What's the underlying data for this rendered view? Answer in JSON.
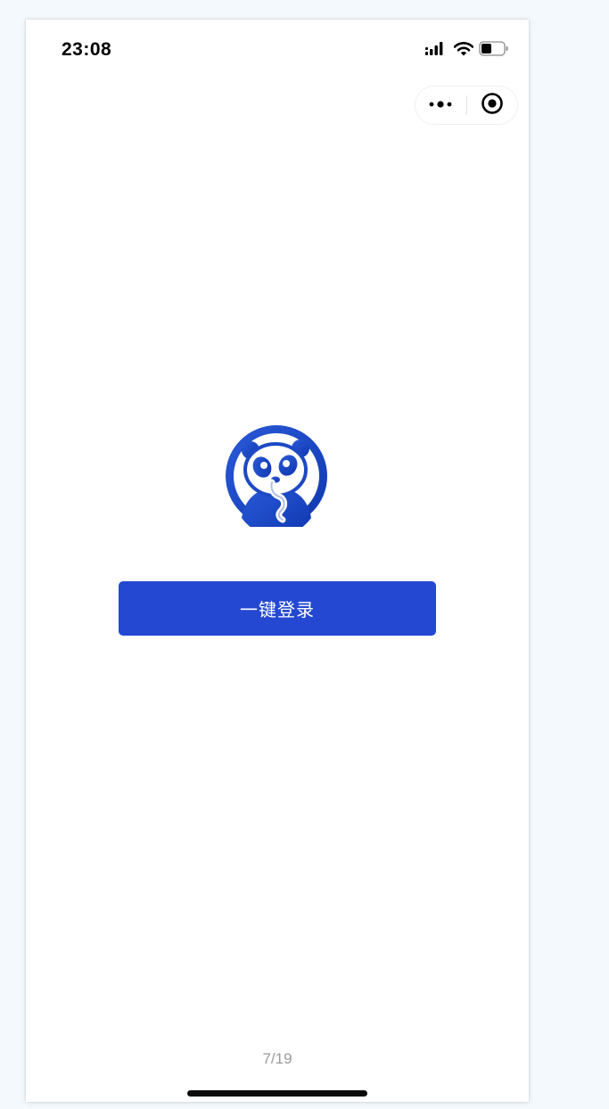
{
  "status_bar": {
    "time": "23:08",
    "icons": [
      "signal-icon",
      "wifi-icon",
      "battery-icon"
    ]
  },
  "capsule": {
    "icons": [
      "more-icon",
      "close-miniprogram-icon"
    ]
  },
  "logo": {
    "icon": "panda-logo-icon"
  },
  "login": {
    "button_label": "一键登录"
  },
  "footer": {
    "page_indicator": "7/19"
  },
  "colors": {
    "accent": "#2448d2",
    "logo_blue": "#1d49c4",
    "background": "#f3f9fc",
    "indicator_text": "#9a9a9a"
  }
}
